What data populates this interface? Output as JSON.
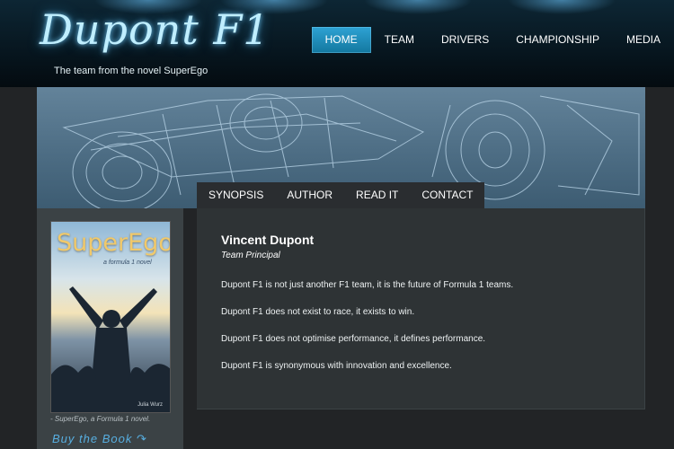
{
  "header": {
    "logo_text": "Dupont F1",
    "tagline": "The team from the novel SuperEgo"
  },
  "main_nav": [
    {
      "label": "HOME",
      "active": true
    },
    {
      "label": "TEAM",
      "active": false
    },
    {
      "label": "DRIVERS",
      "active": false
    },
    {
      "label": "CHAMPIONSHIP",
      "active": false
    },
    {
      "label": "MEDIA",
      "active": false
    }
  ],
  "sub_nav": [
    {
      "label": "SYNOPSIS"
    },
    {
      "label": "AUTHOR"
    },
    {
      "label": "READ IT"
    },
    {
      "label": "CONTACT"
    }
  ],
  "sidebar": {
    "cover_title": "SuperEgo",
    "cover_subtitle": "a formula 1 novel",
    "cover_author": "Julia Wurz",
    "caption": "- SuperEgo, a Formula 1 novel.",
    "buy_link": "Buy the Book ↷"
  },
  "content": {
    "name": "Vincent Dupont",
    "role": "Team Principal",
    "paragraphs": [
      "Dupont F1 is not just another F1 team, it is the future of Formula 1 teams.",
      "Dupont F1 does not exist to race, it exists to win.",
      "Dupont F1 does not optimise performance, it defines performance.",
      "Dupont F1 is synonymous with innovation and excellence."
    ]
  },
  "colors": {
    "accent": "#1e8fc0",
    "header_bg": "#07141c",
    "panel_bg": "#2e3335",
    "sidebar_bg": "#3b4245"
  }
}
